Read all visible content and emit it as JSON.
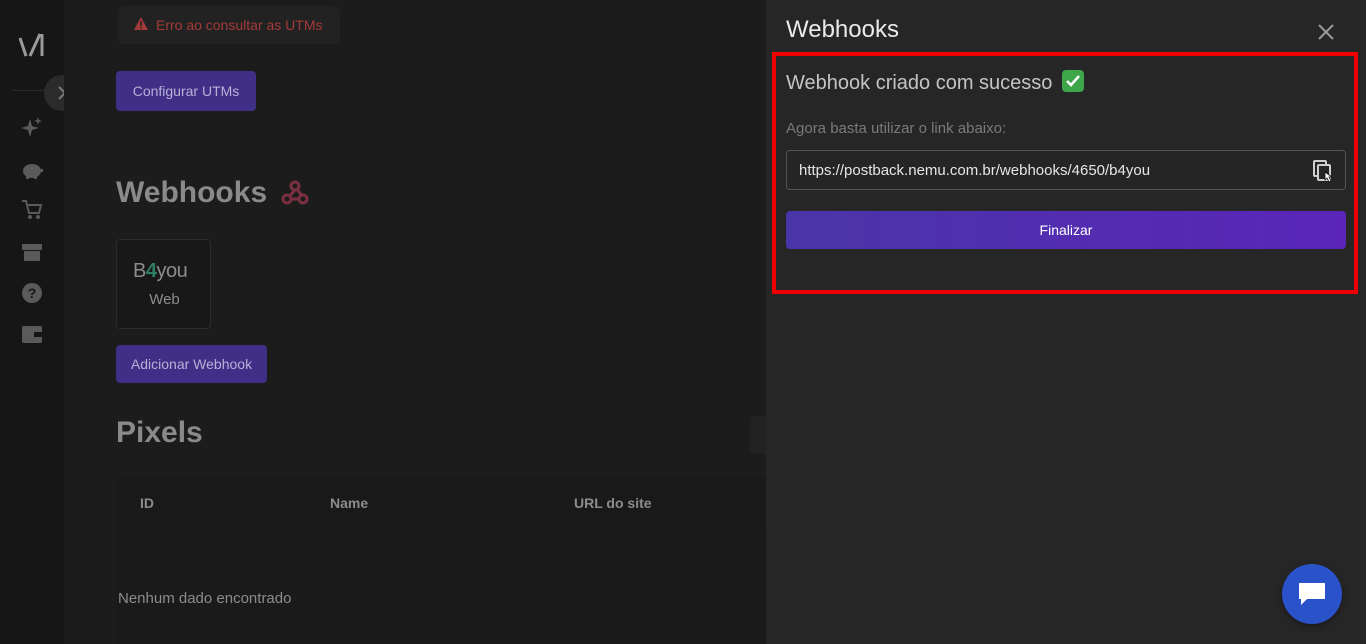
{
  "sidebar": {
    "nav_icons": [
      "sparkles-icon",
      "piggy-bank-icon",
      "cart-icon",
      "box-icon",
      "help-icon",
      "wallet-icon"
    ]
  },
  "main": {
    "error_alert": "Erro ao consultar as UTMs",
    "configure_utms_label": "Configurar UTMs",
    "webhooks_title": "Webhooks",
    "webhook_card": {
      "logo_text_b": "B",
      "logo_text_plus": "4",
      "logo_text_you": "you",
      "label": "Web"
    },
    "add_webhook_label": "Adicionar Webhook",
    "pixels_title": "Pixels",
    "table": {
      "columns": [
        "ID",
        "Name",
        "URL do site"
      ]
    },
    "empty_message": "Nenhum dado encontrado"
  },
  "panel": {
    "title": "Webhooks",
    "success_message": "Webhook criado com sucesso",
    "hint": "Agora basta utilizar o link abaixo:",
    "link": "https://postback.nemu.com.br/webhooks/4650/b4you",
    "finalize_label": "Finalizar"
  },
  "colors": {
    "accent": "#4a35a8",
    "highlight": "#ee0000",
    "error": "#a33a3a",
    "success": "#3da64a",
    "chat": "#2a52c9"
  }
}
